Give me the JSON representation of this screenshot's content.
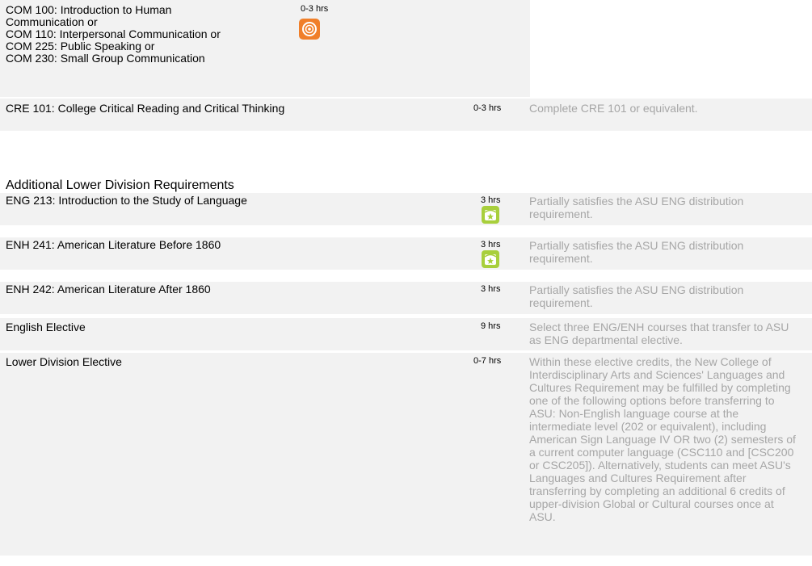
{
  "rows": [
    {
      "course_lines": [
        "COM 100: Introduction to Human",
        "Communication or",
        "COM 110: Interpersonal Communication or",
        "COM 225: Public Speaking or",
        "COM 230: Small Group Communication"
      ],
      "hours": "0-3 hrs",
      "icon": "orange-circle-target-icon"
    },
    {
      "course": "CRE 101: College Critical Reading and Critical Thinking",
      "hours": "0-3 hrs",
      "note": "Complete CRE 101 or equivalent."
    }
  ],
  "section": {
    "title": "Additional Lower Division Requirements",
    "rows": [
      {
        "course": "ENG 213: Introduction to the Study of Language",
        "hours": "3 hrs",
        "note": "Partially satisfies the ASU ENG distribution requirement.",
        "icon": "green-star-badge-icon"
      },
      {
        "course": "ENH 241: American Literature Before 1860",
        "hours": "3 hrs",
        "note": "Partially satisfies the ASU ENG distribution requirement.",
        "icon": "green-star-badge-icon"
      },
      {
        "course": "ENH 242: American Literature After 1860",
        "hours": "3 hrs",
        "note": "Partially satisfies the ASU ENG distribution requirement."
      },
      {
        "course": "English Elective",
        "hours": "9 hrs",
        "note": "Select three ENG/ENH courses that transfer to ASU as ENG departmental elective."
      },
      {
        "course": "Lower Division Elective",
        "hours": "0-7 hrs",
        "note": "Within these elective credits, the New College of Interdisciplinary Arts and Sciences' Languages and Cultures Requirement may be fulfilled by completing one of the following options before transferring to ASU: Non-English language course at the intermediate level (202 or equivalent), including American Sign Language IV OR two (2) semesters of a current computer language (CSC110 and [CSC200 or CSC205]). Alternatively, students can meet ASU's Languages and Cultures Requirement after transferring by completing an additional 6 credits of upper-division Global or Cultural courses once at ASU."
      }
    ]
  },
  "colors": {
    "row_background": "#f2f2f2",
    "note_text": "#a6a6a6",
    "orange_icon": "#f07f2a",
    "green_icon": "#a8cf3c"
  }
}
